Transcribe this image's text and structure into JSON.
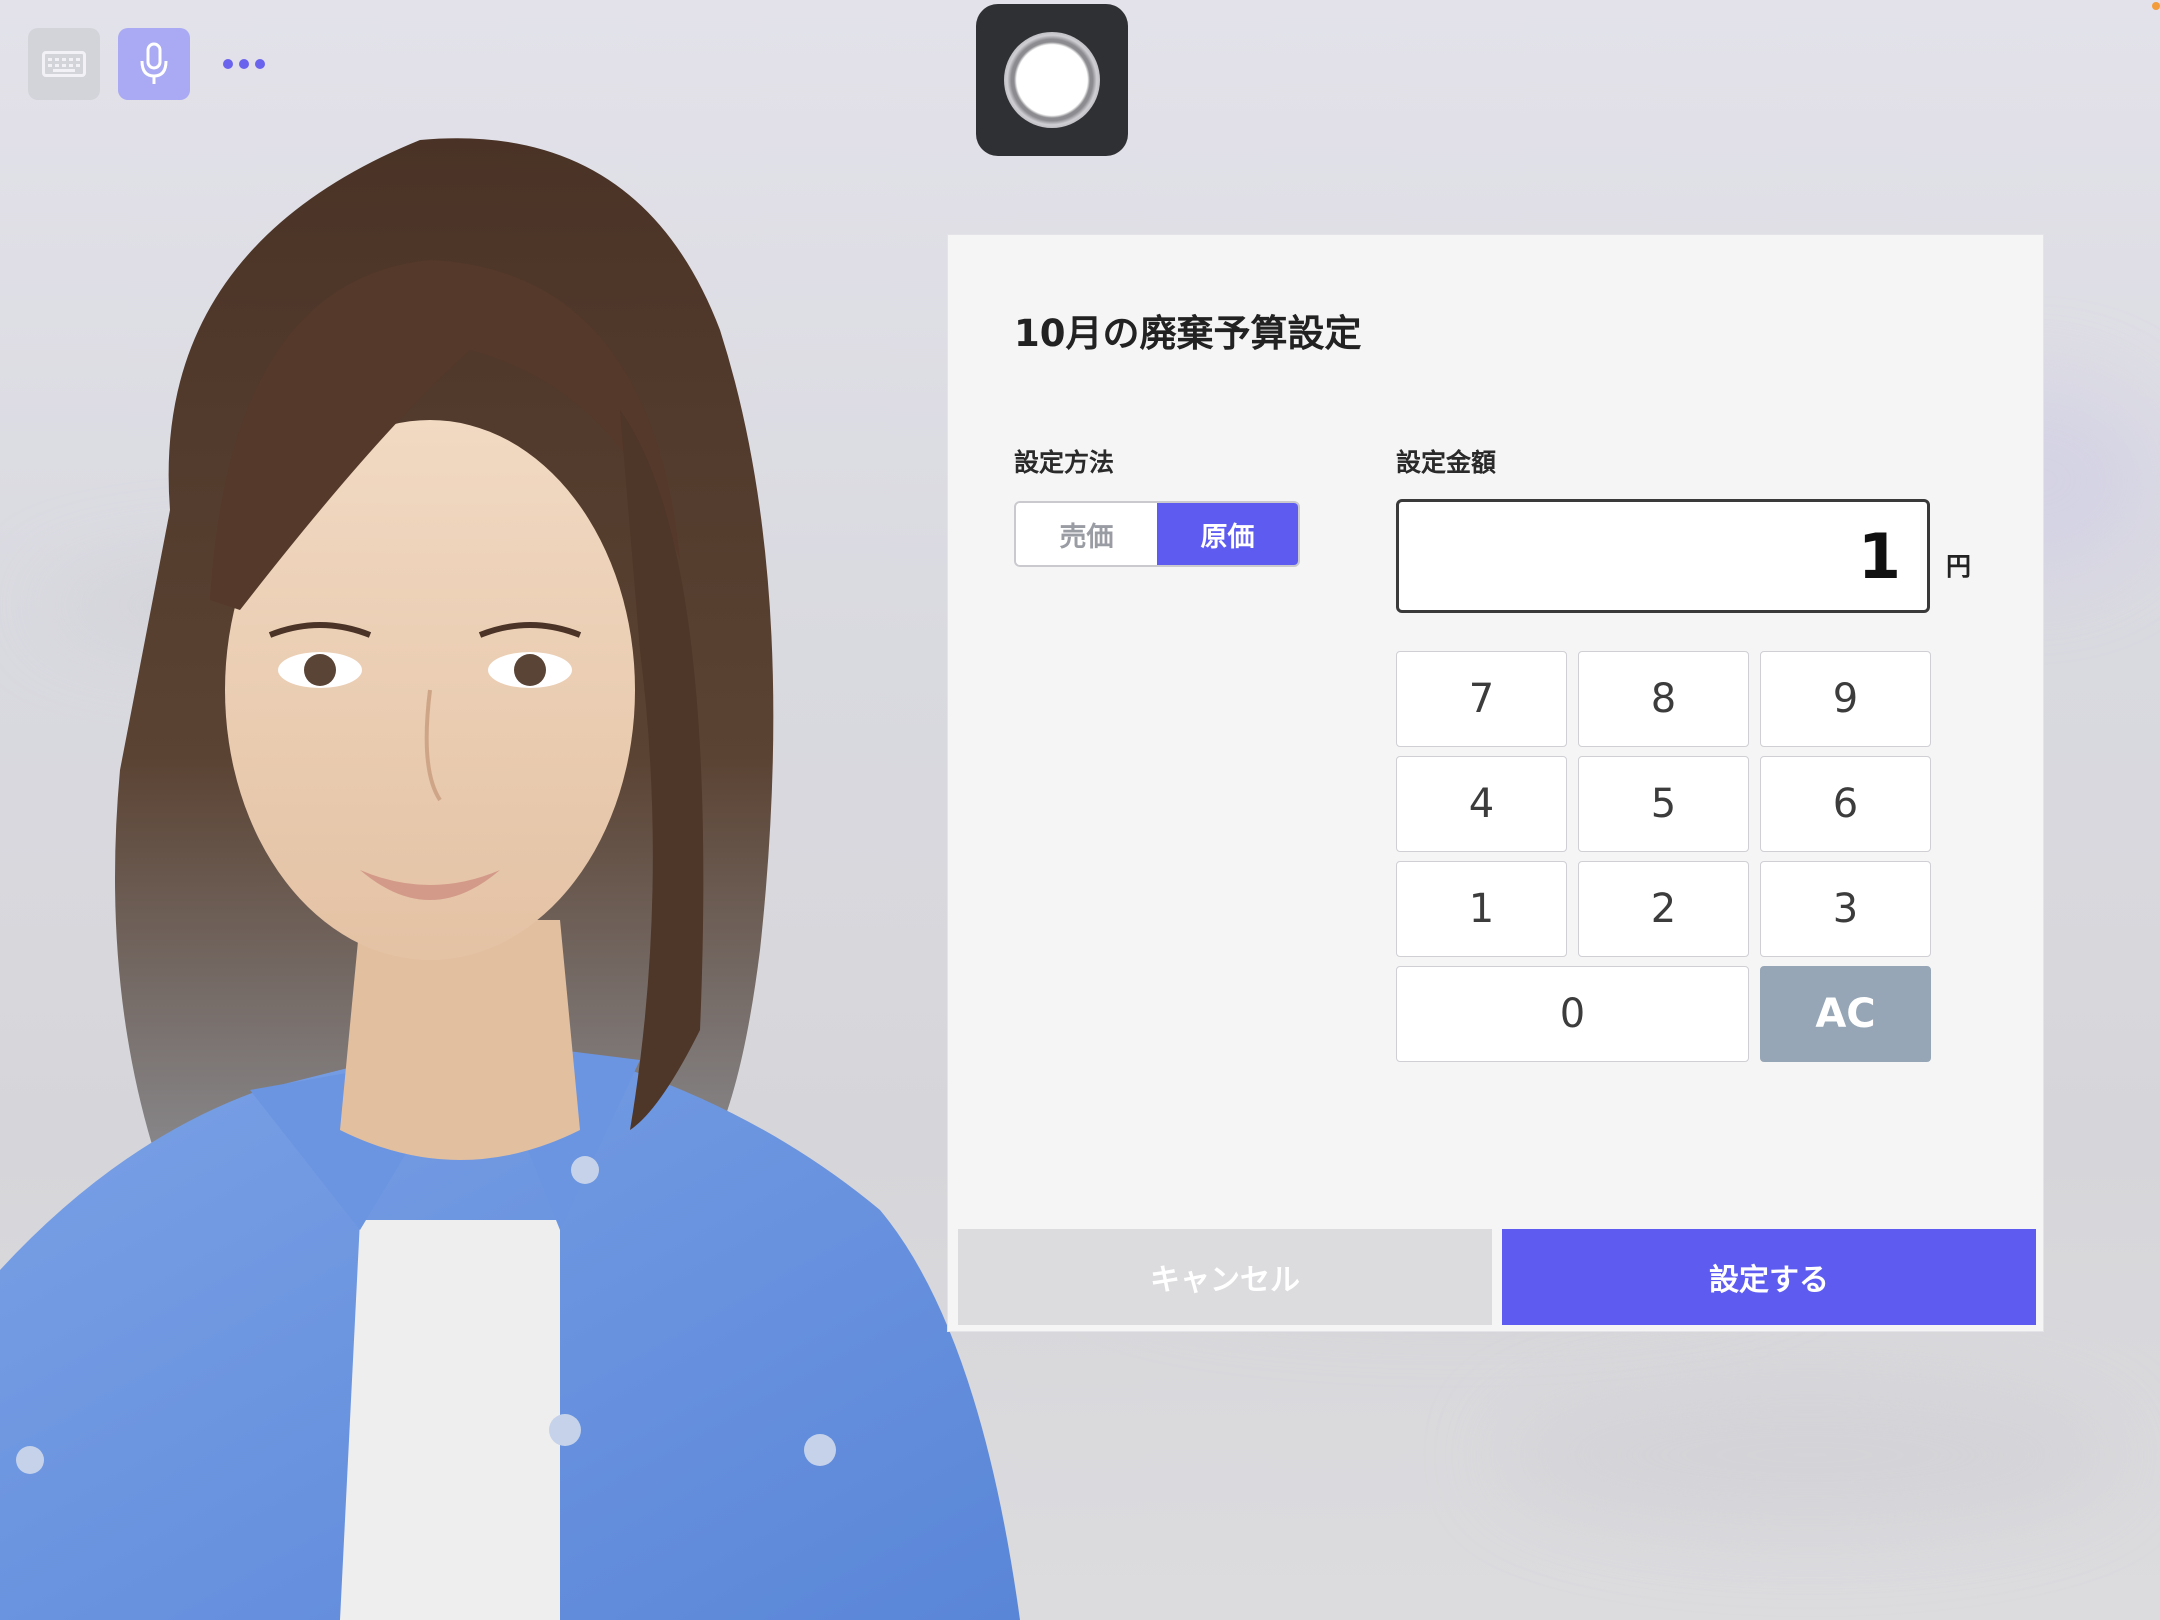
{
  "toolbar": {
    "keyboard_icon": "keyboard-icon",
    "mic_icon": "microphone-icon",
    "more_icon": "more-dots-icon"
  },
  "record_icon": "record-icon",
  "dialog": {
    "title": "10月の廃棄予算設定",
    "method_label": "設定方法",
    "method_options": [
      "売価",
      "原価"
    ],
    "method_selected": "原価",
    "amount_label": "設定金額",
    "amount_value": "1",
    "unit": "円",
    "keypad": {
      "row1": [
        "7",
        "8",
        "9"
      ],
      "row2": [
        "4",
        "5",
        "6"
      ],
      "row3": [
        "1",
        "2",
        "3"
      ],
      "zero": "0",
      "clear": "AC"
    },
    "cancel_label": "キャンセル",
    "submit_label": "設定する"
  },
  "colors": {
    "accent": "#5e5cf0",
    "clear_key": "#96a6b6",
    "cancel_bg": "#dcdcdf",
    "record_bg": "#2f3033"
  }
}
